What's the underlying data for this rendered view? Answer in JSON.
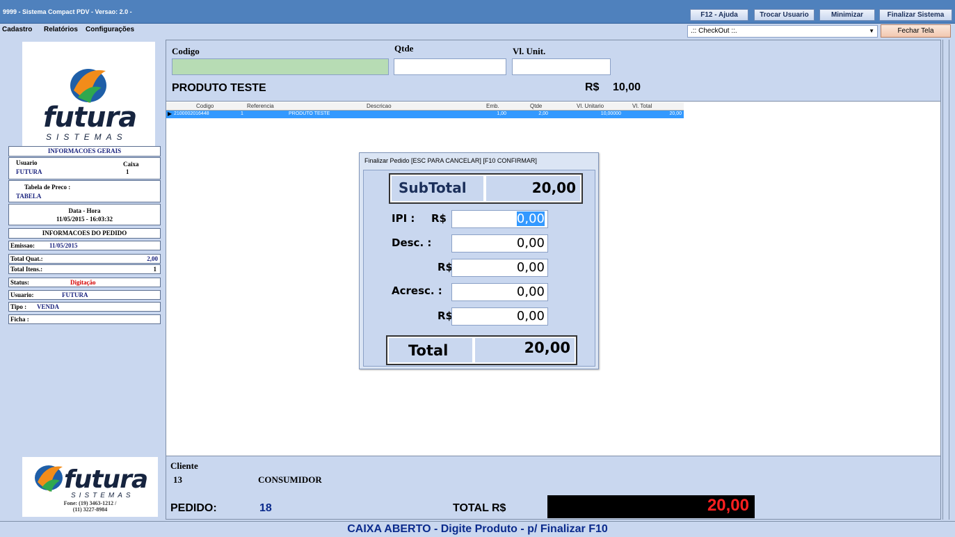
{
  "window": {
    "title": "9999 - Sistema Compact PDV - Versao: 2.0 -",
    "buttons": {
      "help": "F12 - Ajuda",
      "switch_user": "Trocar Usuario",
      "minimize": "Minimizar",
      "exit": "Finalizar Sistema"
    }
  },
  "menu": {
    "items": [
      "Cadastro",
      "Relatórios",
      "Configurações"
    ],
    "checkout_select": ".:: CheckOut ::.",
    "close_screen": "Fechar Tela"
  },
  "logo": {
    "brand": "futura",
    "tagline": "SISTEMAS",
    "phone": "Fone: (19) 3463-1212 /",
    "phone2": "(11) 3227-8984"
  },
  "info": {
    "general_header": "INFORMACOES GERAIS",
    "user_label": "Usuario",
    "user_value": "FUTURA",
    "caixa_label": "Caixa",
    "caixa_value": "1",
    "price_table_label": "Tabela de Preco :",
    "price_table_value": "TABELA",
    "datetime_label": "Data - Hora",
    "datetime_value": "11/05/2015 - 16:03:32",
    "order_header": "INFORMACOES DO PEDIDO",
    "emission_label": "Emissao:",
    "emission_value": "11/05/2015",
    "total_qty_label": "Total Quat.:",
    "total_qty_value": "2,00",
    "total_items_label": "Total Itens.:",
    "total_items_value": "1",
    "status_label": "Status:",
    "status_value": "Digitação",
    "order_user_label": "Usuario:",
    "order_user_value": "FUTURA",
    "type_label": "Tipo :",
    "type_value": "VENDA",
    "file_label": "Ficha :"
  },
  "entry": {
    "code_label": "Codigo",
    "qty_label": "Qtde",
    "unit_label": "Vl. Unit.",
    "product_name": "PRODUTO TESTE",
    "price_label": "R$",
    "price_value": "10,00"
  },
  "grid": {
    "columns": [
      "Codigo",
      "Referencia",
      "Descricao",
      "Emb.",
      "Qtde",
      "Vl. Unitario",
      "Vl. Total"
    ],
    "rows": [
      [
        "2100002016448",
        "1",
        "PRODUTO TESTE",
        "1,00",
        "2,00",
        "10,00000",
        "20,00"
      ]
    ]
  },
  "dialog": {
    "title": "Finalizar Pedido [ESC PARA CANCELAR] [F10 CONFIRMAR]",
    "subtotal_label": "SubTotal",
    "subtotal_value": "20,00",
    "ipi_label": "IPI :",
    "currency": "R$",
    "ipi_value": "0,00",
    "discount_label": "Desc. :",
    "discount_pct_value": "0,00",
    "discount_value": "0,00",
    "surcharge_label": "Acresc. :",
    "surcharge_pct_value": "0,00",
    "surcharge_value": "0,00",
    "total_label": "Total",
    "total_value": "20,00"
  },
  "footer": {
    "client_label": "Cliente",
    "client_code": "13",
    "client_name": "CONSUMIDOR",
    "order_label": "PEDIDO:",
    "order_number": "18",
    "total_label": "TOTAL R$",
    "total_value": "20,00"
  },
  "status": {
    "message": "CAIXA ABERTO - Digite Produto - p/ Finalizar F10"
  },
  "colors": {
    "title_bar": "#4f81bd",
    "panel": "#c9d7ef",
    "selected_row": "#3399ff",
    "total_red": "#ff2020",
    "dark_blue": "#0a2a8c"
  }
}
